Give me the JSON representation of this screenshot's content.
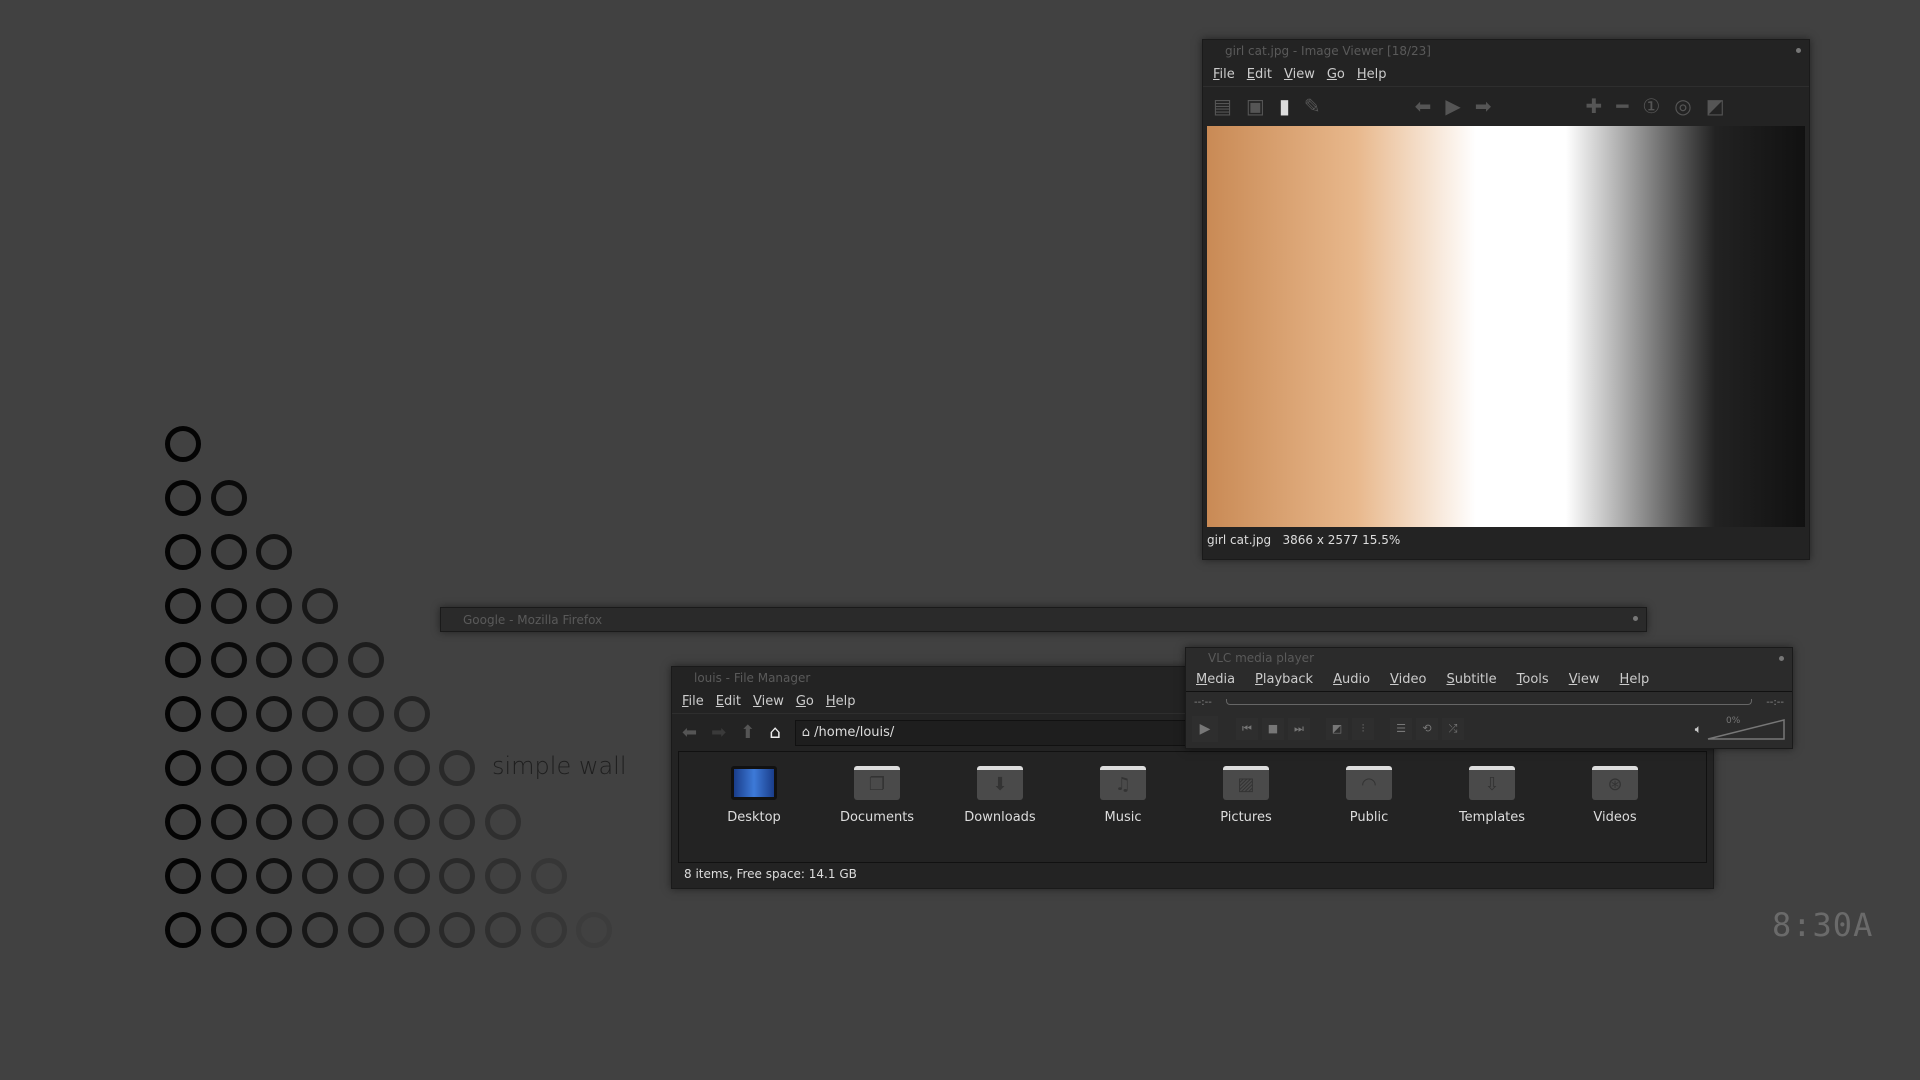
{
  "desktop": {
    "caption": "simple wall",
    "clock": "8:30A",
    "circle_rows": 10
  },
  "image_viewer": {
    "title": "girl cat.jpg - Image Viewer [18/23]",
    "menu": [
      "File",
      "Edit",
      "View",
      "Go",
      "Help"
    ],
    "toolbar": [
      "open-icon",
      "save-icon",
      "delete-icon",
      "edit-icon",
      "previous-icon",
      "play-icon",
      "next-icon",
      "zoom-in-icon",
      "zoom-out-icon",
      "zoom-actual-icon",
      "zoom-fit-icon",
      "fullscreen-icon"
    ],
    "status": {
      "filename": "girl cat.jpg",
      "info": "3866 x 2577 15.5%"
    }
  },
  "firefox": {
    "title": "Google - Mozilla Firefox"
  },
  "file_manager": {
    "title": "louis - File Manager",
    "menu": [
      "File",
      "Edit",
      "View",
      "Go",
      "Help"
    ],
    "path": "/home/louis/",
    "items": [
      {
        "label": "Desktop",
        "icon": "monitor-icon"
      },
      {
        "label": "Documents",
        "icon": "documents-folder-icon"
      },
      {
        "label": "Downloads",
        "icon": "downloads-folder-icon"
      },
      {
        "label": "Music",
        "icon": "music-folder-icon"
      },
      {
        "label": "Pictures",
        "icon": "pictures-folder-icon"
      },
      {
        "label": "Public",
        "icon": "public-folder-icon"
      },
      {
        "label": "Templates",
        "icon": "templates-folder-icon"
      },
      {
        "label": "Videos",
        "icon": "videos-folder-icon"
      }
    ],
    "status": "8 items, Free space: 14.1 GB"
  },
  "vlc": {
    "title": "VLC media player",
    "menu": [
      "Media",
      "Playback",
      "Audio",
      "Video",
      "Subtitle",
      "Tools",
      "View",
      "Help"
    ],
    "time_elapsed": "--:--",
    "time_total": "--:--",
    "volume": "0%"
  }
}
